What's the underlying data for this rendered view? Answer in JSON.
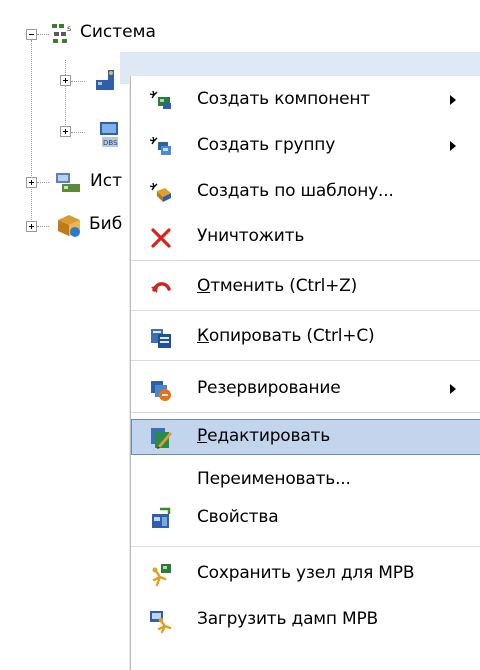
{
  "tree": {
    "root": {
      "label": "Система",
      "icon": "network-structure-icon",
      "expanded": true
    },
    "children": [
      {
        "label": "",
        "icon": "server-component-icon",
        "expanded": false,
        "selected": true
      },
      {
        "label": "",
        "icon": "database-computer-icon",
        "expanded": false
      }
    ],
    "siblings": [
      {
        "label": "Ист",
        "icon": "data-source-icon",
        "expanded": false
      },
      {
        "label": "Биб",
        "icon": "library-icon",
        "expanded": false
      }
    ]
  },
  "menu": {
    "items": [
      {
        "label": "Создать компонент",
        "icon": "new-component-icon",
        "submenu": true
      },
      {
        "label": "Создать группу",
        "icon": "new-group-icon",
        "submenu": true
      },
      {
        "label": "Создать по шаблону...",
        "icon": "create-from-template-icon",
        "submenu": false
      },
      {
        "label": "Уничтожить",
        "icon": "delete-x-icon",
        "submenu": false
      },
      {
        "label": "Отменить (Ctrl+Z)",
        "accel_letter": "О",
        "rest": "тменить (Ctrl+Z)",
        "icon": "undo-icon",
        "submenu": false
      },
      {
        "label": "Копировать (Ctrl+C)",
        "accel_letter": "К",
        "rest": "опировать (Ctrl+C)",
        "icon": "copy-icon",
        "submenu": false
      },
      {
        "label": "Резервирование",
        "icon": "redundancy-icon",
        "submenu": true
      },
      {
        "label": "Редактировать",
        "accel_letter": "Р",
        "rest": "едактировать",
        "icon": "edit-icon",
        "submenu": false,
        "highlighted": true
      },
      {
        "label": "Переименовать...",
        "icon": "",
        "submenu": false
      },
      {
        "label": "Свойства",
        "icon": "properties-icon",
        "submenu": false
      },
      {
        "label": "Сохранить узел для МРВ",
        "icon": "save-node-icon",
        "submenu": false
      },
      {
        "label": "Загрузить дамп МРВ",
        "icon": "load-dump-icon",
        "submenu": false
      }
    ]
  },
  "colors": {
    "selection_fill": "#c3d5ec",
    "selection_border": "#6a8ab5",
    "tree_selection": "#dfe9f6",
    "delete_red": "#e0201a",
    "undo_red": "#c8281e"
  }
}
